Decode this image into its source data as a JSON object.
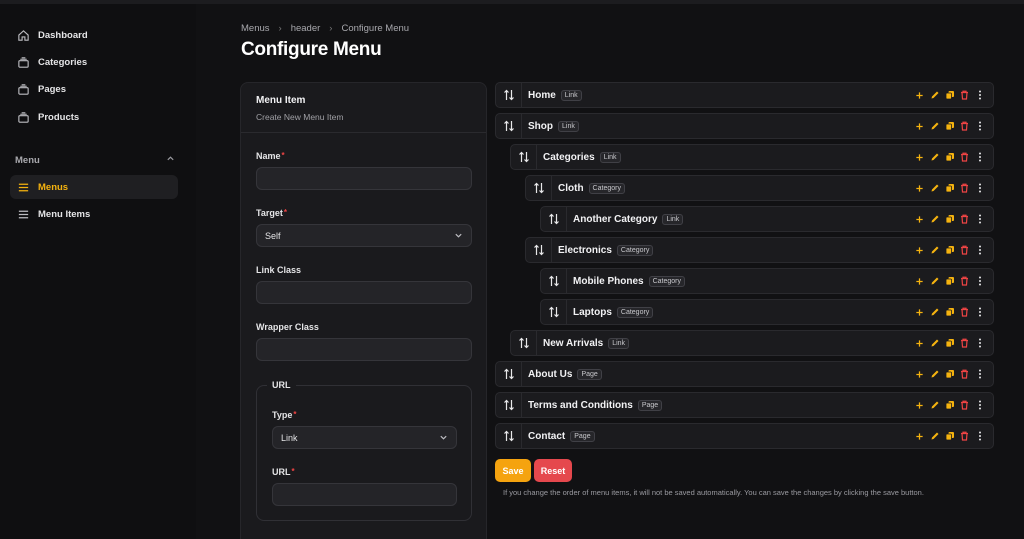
{
  "sidebar": {
    "items": [
      {
        "label": "Dashboard",
        "icon": "home-icon"
      },
      {
        "label": "Categories",
        "icon": "stack-icon"
      },
      {
        "label": "Pages",
        "icon": "stack-icon"
      },
      {
        "label": "Products",
        "icon": "stack-icon"
      }
    ],
    "section_label": "Menu",
    "section_items": [
      {
        "label": "Menus",
        "icon": "bars-icon",
        "active": true
      },
      {
        "label": "Menu Items",
        "icon": "bars-icon",
        "active": false
      }
    ]
  },
  "breadcrumb": [
    "Menus",
    "header",
    "Configure Menu"
  ],
  "page_title": "Configure Menu",
  "form": {
    "title": "Menu Item",
    "subtitle": "Create New Menu Item",
    "name_label": "Name",
    "name_value": "",
    "target_label": "Target",
    "target_value": "Self",
    "link_class_label": "Link Class",
    "link_class_value": "",
    "wrapper_class_label": "Wrapper Class",
    "wrapper_class_value": "",
    "url_group_label": "URL",
    "type_label": "Type",
    "type_value": "Link",
    "url_label": "URL",
    "url_value": ""
  },
  "menu_tree": [
    {
      "label": "Home",
      "type": "Link",
      "depth": 0
    },
    {
      "label": "Shop",
      "type": "Link",
      "depth": 0
    },
    {
      "label": "Categories",
      "type": "Link",
      "depth": 1
    },
    {
      "label": "Cloth",
      "type": "Category",
      "depth": 2
    },
    {
      "label": "Another Category",
      "type": "Link",
      "depth": 3
    },
    {
      "label": "Electronics",
      "type": "Category",
      "depth": 2
    },
    {
      "label": "Mobile Phones",
      "type": "Category",
      "depth": 3
    },
    {
      "label": "Laptops",
      "type": "Category",
      "depth": 3
    },
    {
      "label": "New Arrivals",
      "type": "Link",
      "depth": 1
    },
    {
      "label": "About Us",
      "type": "Page",
      "depth": 0
    },
    {
      "label": "Terms and Conditions",
      "type": "Page",
      "depth": 0
    },
    {
      "label": "Contact",
      "type": "Page",
      "depth": 0
    }
  ],
  "buttons": {
    "save": "Save",
    "reset": "Reset"
  },
  "hint": "If you change the order of menu items, it will not be saved automatically. You can save the changes by clicking the save button.",
  "colors": {
    "accent": "#f5b30f",
    "danger": "#ef4444",
    "background": "#111113",
    "panel": "#1a1a1d"
  }
}
